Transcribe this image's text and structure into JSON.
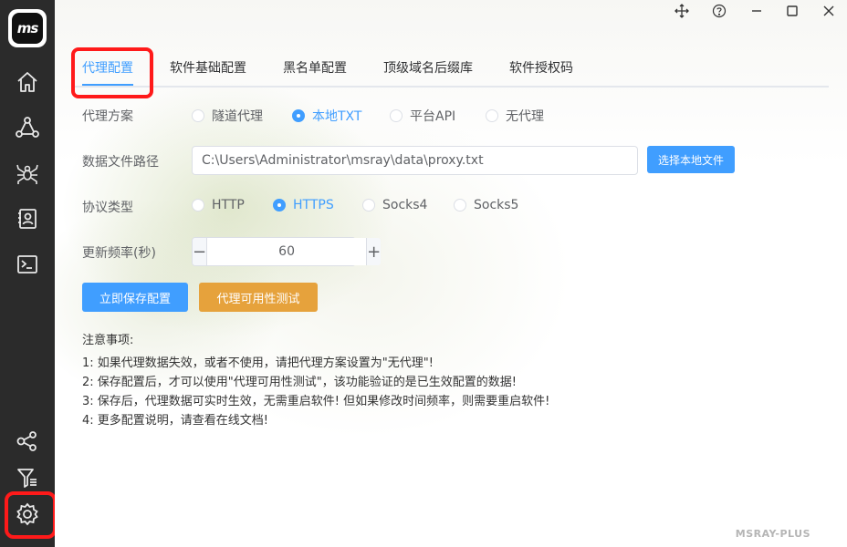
{
  "sidebar": {
    "logo_text": "ms",
    "icons": [
      "home-icon",
      "network-icon",
      "spider-icon",
      "contacts-icon",
      "terminal-icon",
      "share-icon",
      "filter-icon",
      "gear-icon"
    ]
  },
  "tabs": [
    {
      "label": "代理配置",
      "active": true
    },
    {
      "label": "软件基础配置",
      "active": false
    },
    {
      "label": "黑名单配置",
      "active": false
    },
    {
      "label": "顶级域名后缀库",
      "active": false
    },
    {
      "label": "软件授权码",
      "active": false
    }
  ],
  "form": {
    "scheme_label": "代理方案",
    "scheme_options": [
      "隧道代理",
      "本地TXT",
      "平台API",
      "无代理"
    ],
    "scheme_selected": "本地TXT",
    "path_label": "数据文件路径",
    "path_value": "C:\\Users\\Administrator\\msray\\data\\proxy.txt",
    "choose_file_button": "选择本地文件",
    "protocol_label": "协议类型",
    "protocol_options": [
      "HTTP",
      "HTTPS",
      "Socks4",
      "Socks5"
    ],
    "protocol_selected": "HTTPS",
    "refresh_label": "更新频率(秒)",
    "refresh_value": "60",
    "minus_label": "−",
    "plus_label": "+",
    "save_button": "立即保存配置",
    "test_button": "代理可用性测试"
  },
  "notes": {
    "title": "注意事项:",
    "items": [
      "1: 如果代理数据失效，或者不使用，请把代理方案设置为\"无代理\"!",
      "2: 保存配置后，才可以使用\"代理可用性测试\"，该功能验证的是已生效配置的数据!",
      "3: 保存后，代理数据可实时生效，无需重启软件! 但如果修改时间频率，则需要重启软件!",
      "4: 更多配置说明，请查看在线文档!"
    ]
  },
  "brand": "MSRAY-PLUS",
  "colors": {
    "sidebar_bg": "#2b2b2b",
    "primary": "#409eff",
    "warning": "#e6a23c",
    "annotation_red": "#ff1a1a"
  }
}
